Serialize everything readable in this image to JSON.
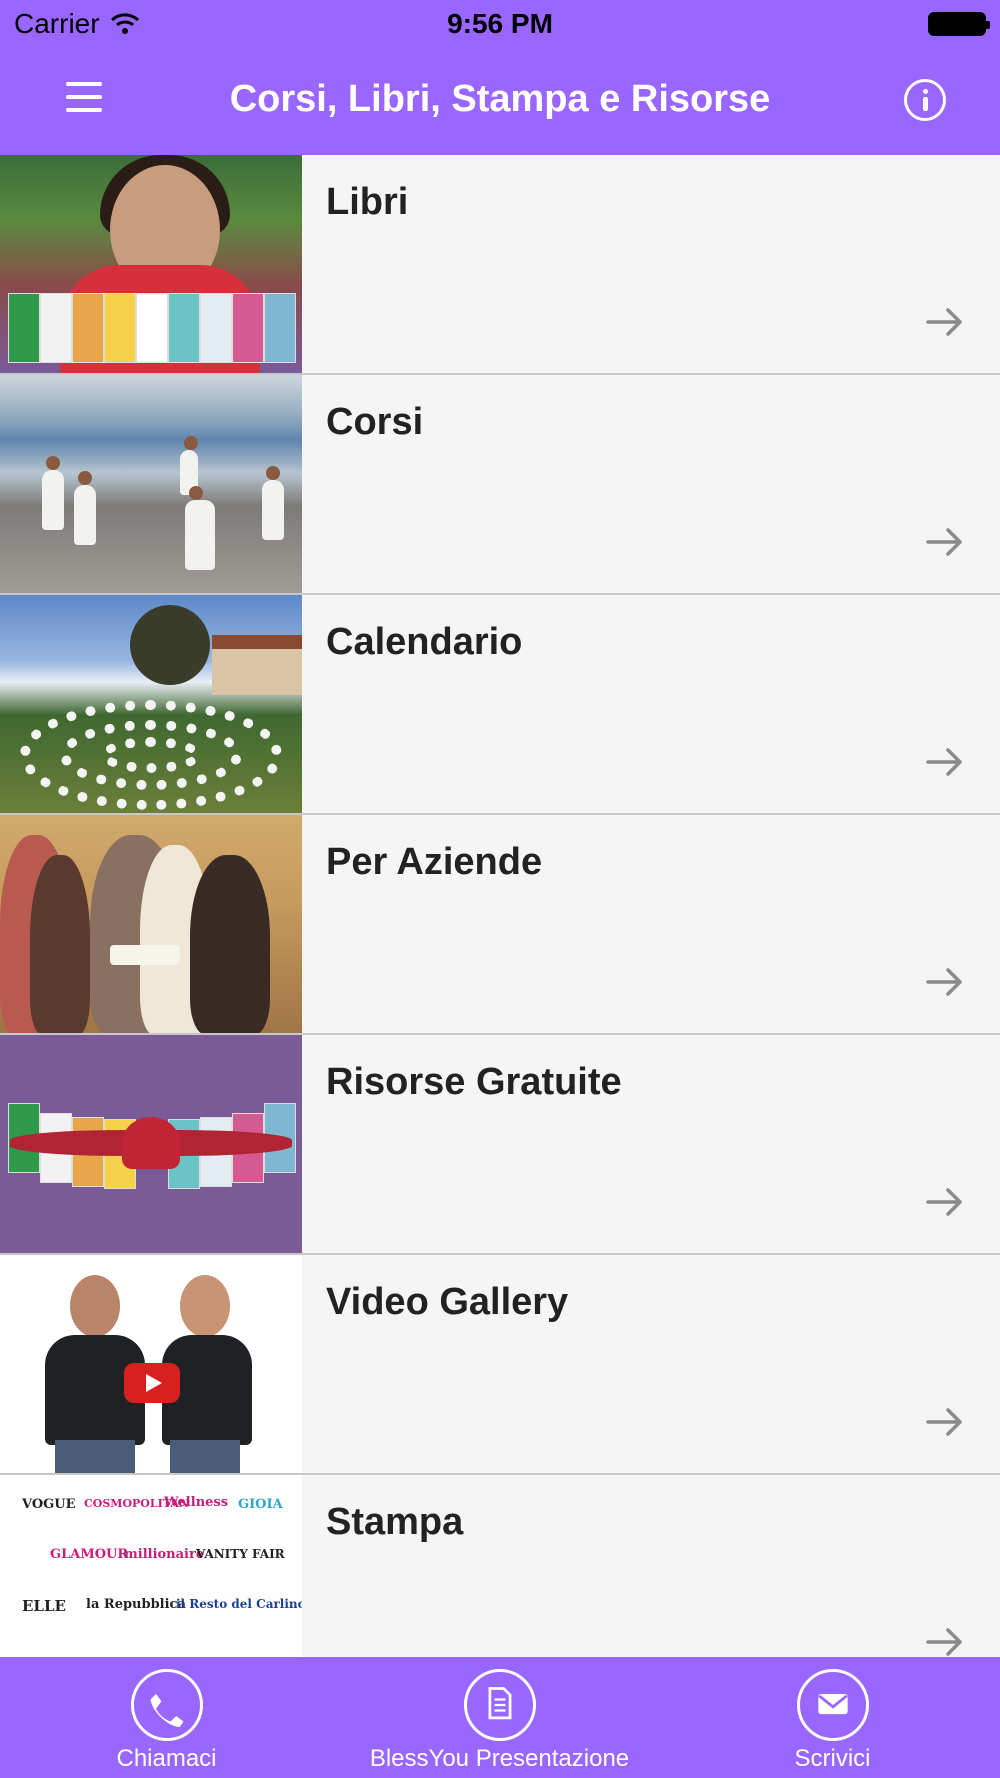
{
  "status_bar": {
    "carrier": "Carrier",
    "time": "9:56 PM"
  },
  "nav": {
    "title": "Corsi, Libri, Stampa e Risorse"
  },
  "list": {
    "items": [
      {
        "label": "Libri"
      },
      {
        "label": "Corsi"
      },
      {
        "label": "Calendario"
      },
      {
        "label": "Per Aziende"
      },
      {
        "label": "Risorse Gratuite"
      },
      {
        "label": "Video Gallery"
      },
      {
        "label": "Stampa"
      }
    ]
  },
  "press_logos": [
    "VOGUE",
    "COSMOPOLITAN",
    "Wellness",
    "GIOIA",
    "GLAMOUR",
    "millionaire",
    "VANITY FAIR",
    "ELLE",
    "la Repubblica",
    "il Resto del Carlino"
  ],
  "tabs": [
    {
      "label": "Chiamaci",
      "icon": "phone-icon"
    },
    {
      "label": "BlessYou Presentazione",
      "icon": "document-icon"
    },
    {
      "label": "Scrivici",
      "icon": "envelope-icon"
    }
  ],
  "colors": {
    "brand": "#9966ff",
    "row_bg": "#f5f5f5",
    "separator": "#c8c8c8",
    "arrow": "#8a8a8a"
  }
}
